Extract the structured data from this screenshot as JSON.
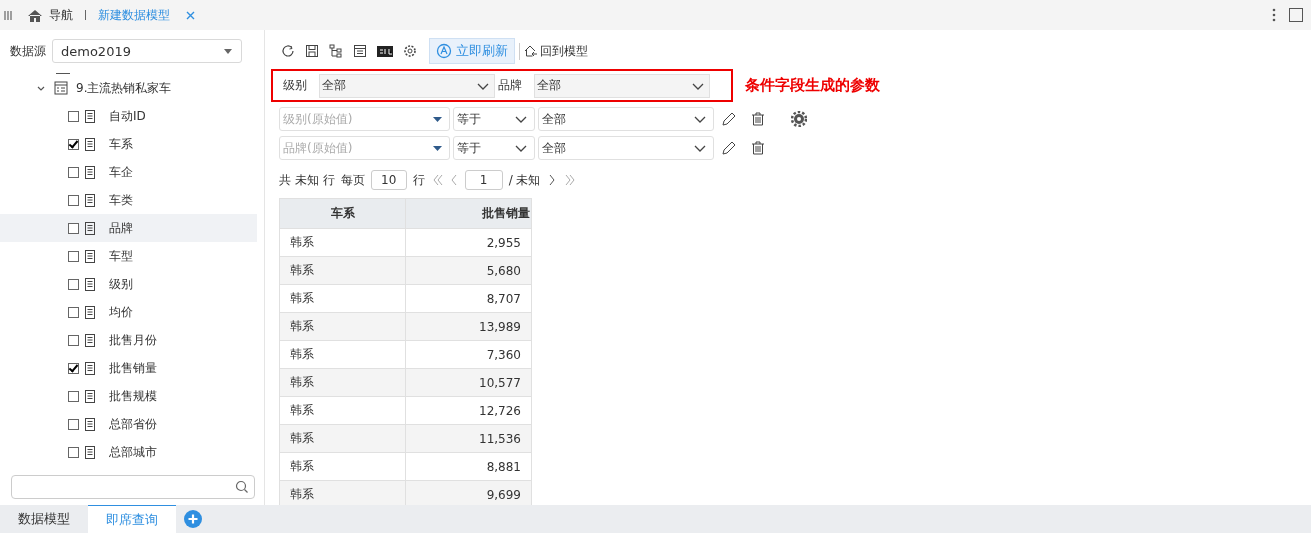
{
  "top_bar": {
    "nav_label": "导航",
    "tabs": [
      {
        "label": "新建数据模型",
        "selected": true
      }
    ]
  },
  "sidebar": {
    "datasource_label": "数据源",
    "datasource_value": "demo2019",
    "tree": [
      {
        "label": "9.主流热销私家车",
        "expanded": true,
        "children": [
          {
            "label": "自动ID",
            "checked": false,
            "selected": false
          },
          {
            "label": "车系",
            "checked": true,
            "selected": false
          },
          {
            "label": "车企",
            "checked": false,
            "selected": false
          },
          {
            "label": "车类",
            "checked": false,
            "selected": false
          },
          {
            "label": "品牌",
            "checked": false,
            "selected": true
          },
          {
            "label": "车型",
            "checked": false,
            "selected": false
          },
          {
            "label": "级别",
            "checked": false,
            "selected": false
          },
          {
            "label": "均价",
            "checked": false,
            "selected": false
          },
          {
            "label": "批售月份",
            "checked": false,
            "selected": false
          },
          {
            "label": "批售销量",
            "checked": true,
            "selected": false
          },
          {
            "label": "批售规模",
            "checked": false,
            "selected": false
          },
          {
            "label": "总部省份",
            "checked": false,
            "selected": false
          },
          {
            "label": "总部城市",
            "checked": false,
            "selected": false
          }
        ]
      }
    ]
  },
  "toolbar": {
    "refresh_now": "立即刷新",
    "back_to_model": "回到模型"
  },
  "params": [
    {
      "label": "级别",
      "value": "全部"
    },
    {
      "label": "品牌",
      "value": "全部"
    }
  ],
  "params_annotation": "条件字段生成的参数",
  "conditions": [
    {
      "field": "级别(原始值)",
      "operator": "等于",
      "value": "全部",
      "has_settings": true
    },
    {
      "field": "品牌(原始值)",
      "operator": "等于",
      "value": "全部",
      "has_settings": false
    }
  ],
  "pagination": {
    "total": "共 未知 行",
    "per_page_label": "每页",
    "per_page": "10",
    "rows_label": "行",
    "page": "1",
    "page_total": "/ 未知"
  },
  "table": {
    "columns": [
      "车系",
      "批售销量"
    ],
    "rows": [
      [
        "韩系",
        "2,955"
      ],
      [
        "韩系",
        "5,680"
      ],
      [
        "韩系",
        "8,707"
      ],
      [
        "韩系",
        "13,989"
      ],
      [
        "韩系",
        "7,360"
      ],
      [
        "韩系",
        "10,577"
      ],
      [
        "韩系",
        "12,726"
      ],
      [
        "韩系",
        "11,536"
      ],
      [
        "韩系",
        "8,881"
      ],
      [
        "韩系",
        "9,699"
      ]
    ]
  },
  "bottom_tabs": [
    {
      "label": "数据模型",
      "selected": false
    },
    {
      "label": "即席查询",
      "selected": true
    }
  ]
}
